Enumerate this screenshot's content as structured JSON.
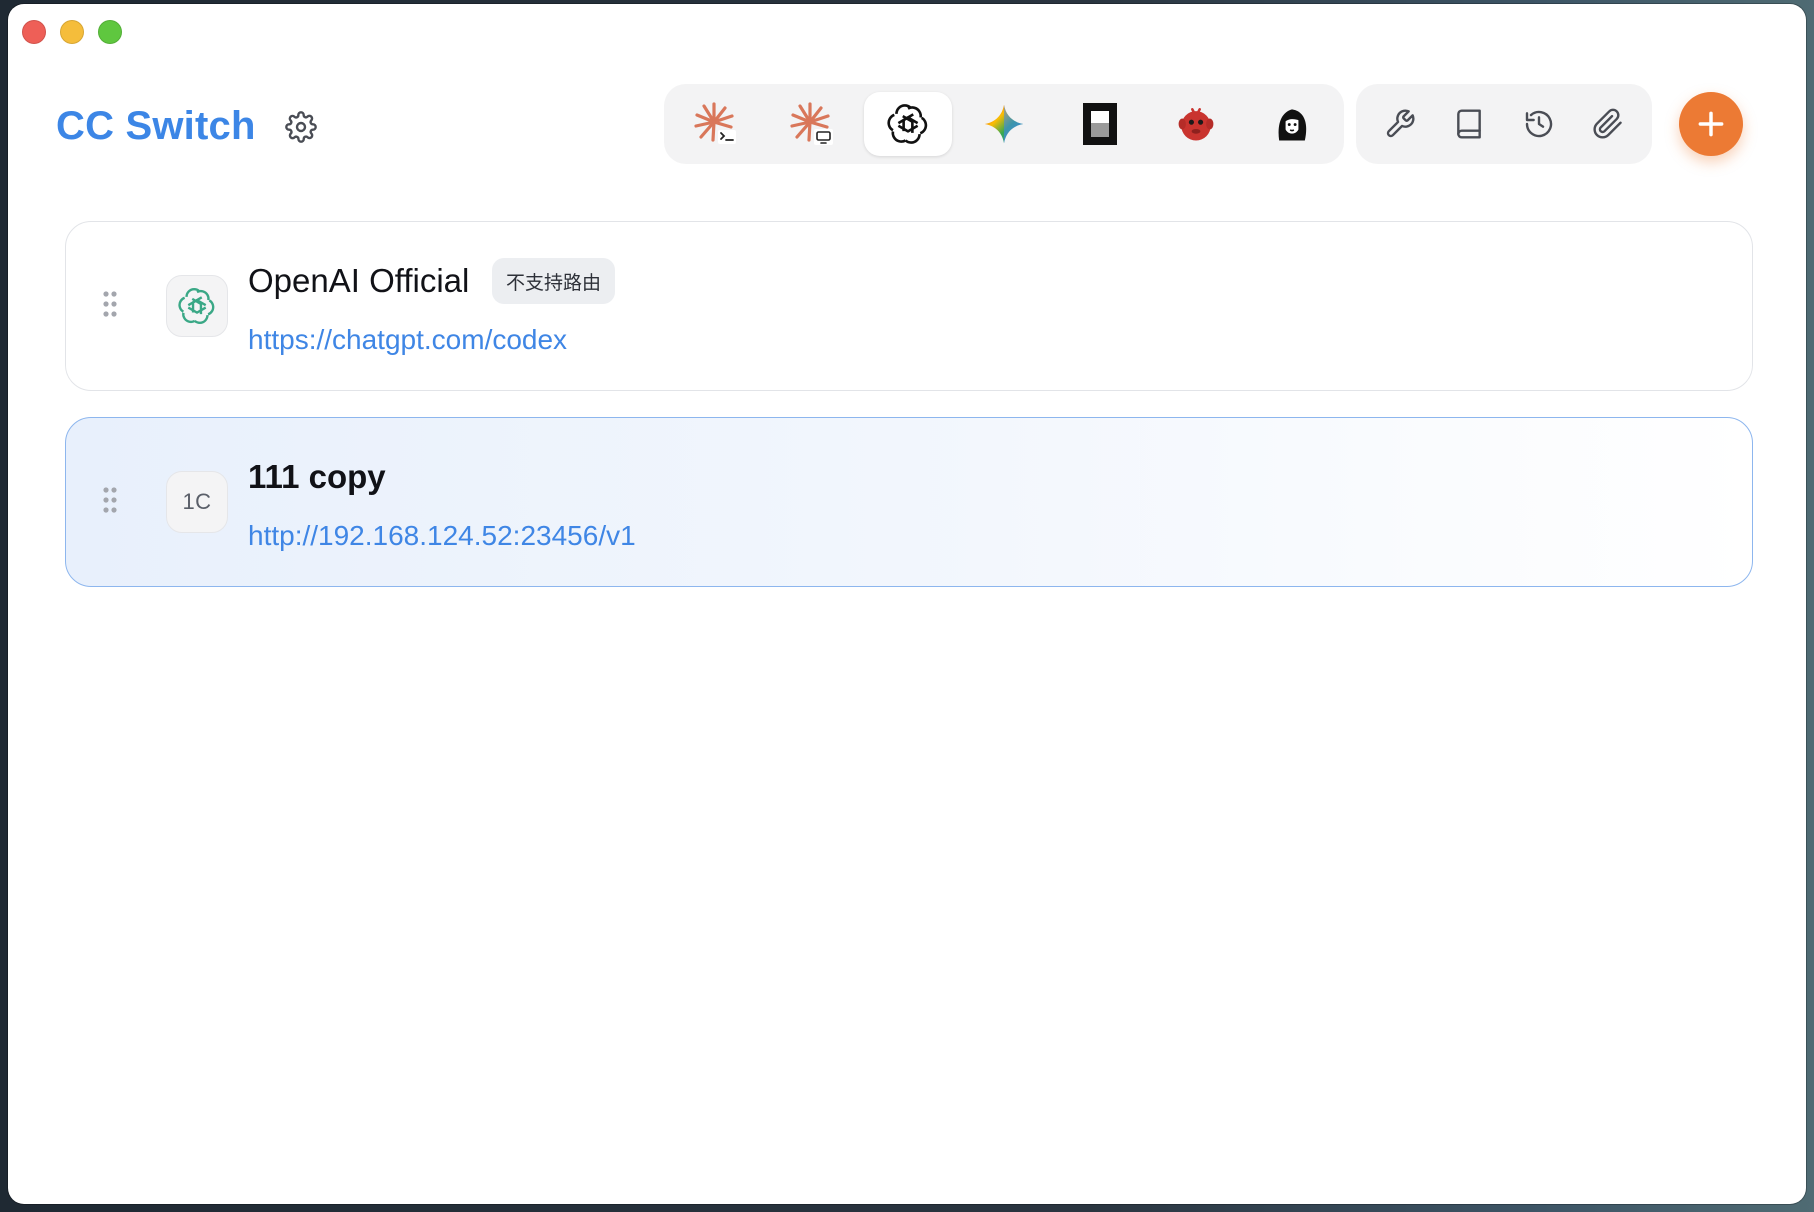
{
  "app": {
    "title": "CC Switch"
  },
  "toolbar": {
    "apps": [
      {
        "name": "claude-code",
        "icon": "claude-terminal-icon",
        "active": false
      },
      {
        "name": "claude-desktop",
        "icon": "claude-desktop-icon",
        "active": false
      },
      {
        "name": "codex",
        "icon": "openai-icon",
        "active": true
      },
      {
        "name": "gemini",
        "icon": "gemini-sparkle-icon",
        "active": false
      },
      {
        "name": "opencode",
        "icon": "opencode-block-icon",
        "active": false
      },
      {
        "name": "red-mascot",
        "icon": "red-mascot-icon",
        "active": false
      },
      {
        "name": "character",
        "icon": "character-portrait-icon",
        "active": false
      }
    ],
    "utilities": [
      {
        "name": "tools",
        "icon": "wrench-icon"
      },
      {
        "name": "docs",
        "icon": "book-icon"
      },
      {
        "name": "history",
        "icon": "history-icon"
      },
      {
        "name": "attachments",
        "icon": "paperclip-icon"
      }
    ],
    "add_icon": "plus-icon"
  },
  "providers": [
    {
      "name": "OpenAI Official",
      "badge": "不支持路由",
      "url": "https://chatgpt.com/codex",
      "icon": "openai-icon",
      "selected": false
    },
    {
      "name": "111 copy",
      "initials": "1C",
      "url": "http://192.168.124.52:23456/v1",
      "selected": true
    }
  ],
  "colors": {
    "accent": "#3c86e6",
    "add_button": "#ec7a34",
    "selected_border": "#8db6ee",
    "openai_green": "#3aa886"
  }
}
